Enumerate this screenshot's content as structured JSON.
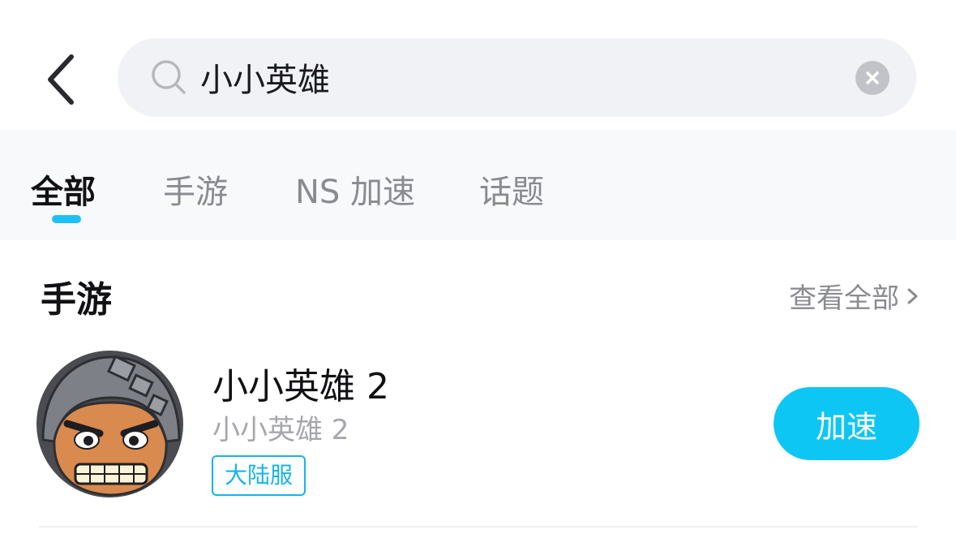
{
  "search": {
    "query": "小小英雄"
  },
  "tabs": [
    {
      "label": "全部",
      "active": true
    },
    {
      "label": "手游",
      "active": false
    },
    {
      "label": "NS 加速",
      "active": false
    },
    {
      "label": "话题",
      "active": false
    }
  ],
  "section": {
    "title": "手游",
    "view_all_label": "查看全部"
  },
  "game": {
    "name": "小小英雄 2",
    "subtitle": "小小英雄 2",
    "badge": "大陆服",
    "action_label": "加速",
    "avatar_icon": "helmeted-hero-face"
  },
  "colors": {
    "accent": "#0ec6f4",
    "badge": "#16b4e8",
    "search_bg": "#f1f2f6",
    "tabs_bg": "#f8f9fb"
  }
}
